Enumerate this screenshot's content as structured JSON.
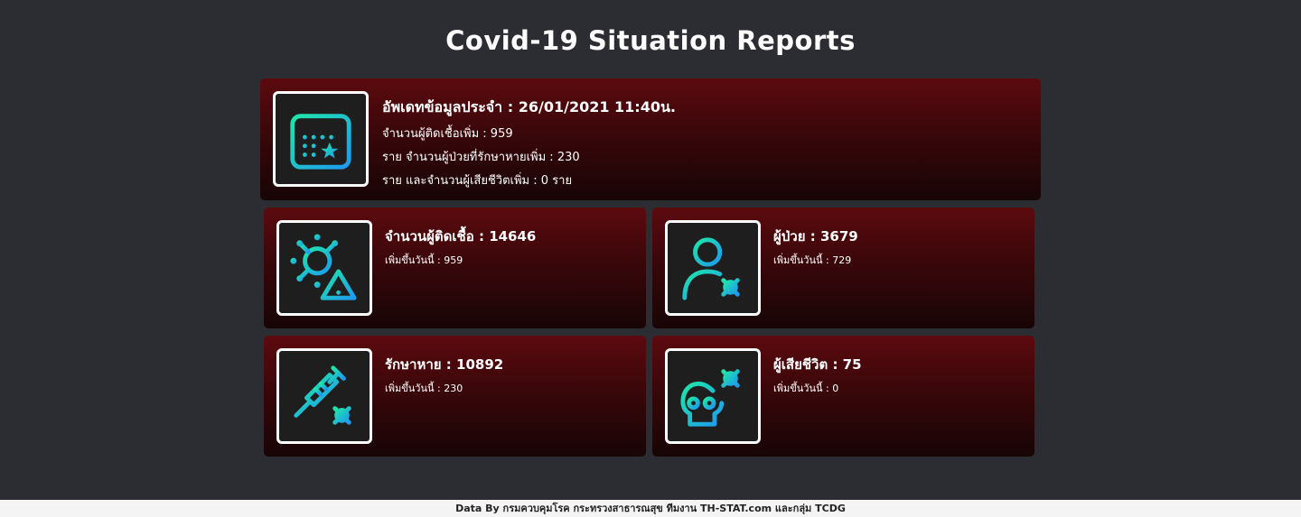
{
  "page": {
    "title": "Covid-19 Situation Reports"
  },
  "update": {
    "label": "อัพเดทข้อมูลประจำ",
    "datetime": "26/01/2021 11:40น.",
    "line1": "จำนวนผู้ติดเชื้อเพิ่ม : 959",
    "line2": "ราย จำนวนผู้ป่วยที่รักษาหายเพิ่ม : 230",
    "line3": "ราย และจำนวนผู้เสียชีวิตเพิ่ม : 0 ราย",
    "icon": "calendar-star-icon"
  },
  "stats": [
    {
      "label": "จำนวนผู้ติดเชื้อ",
      "value": "14646",
      "sub": "เพิ่มขึ้นวันนี้ : 959",
      "icon": "virus-warning-icon"
    },
    {
      "label": "ผู้ป่วย",
      "value": "3679",
      "sub": "เพิ่มขึ้นวันนี้ : 729",
      "icon": "patient-virus-icon"
    },
    {
      "label": "รักษาหาย",
      "value": "10892",
      "sub": "เพิ่มขึ้นวันนี้ : 230",
      "icon": "vaccine-syringe-icon"
    },
    {
      "label": "ผู้เสียชีวิต",
      "value": "75",
      "sub": "เพิ่มขึ้นวันนี้ : 0",
      "icon": "skull-virus-icon"
    }
  ],
  "separator": " : ",
  "footer": {
    "text": "Data By กรมควบคุมโรค กระทรวงสาธารณสุข ทีมงาน TH-STAT.com และกลุ่ม TCDG"
  },
  "colors": {
    "background": "#2c2c33",
    "card_top": "#5c0a0e",
    "card_bottom": "#170506",
    "icon_gradient_start": "#1ee6a8",
    "icon_gradient_end": "#1e9af0"
  }
}
